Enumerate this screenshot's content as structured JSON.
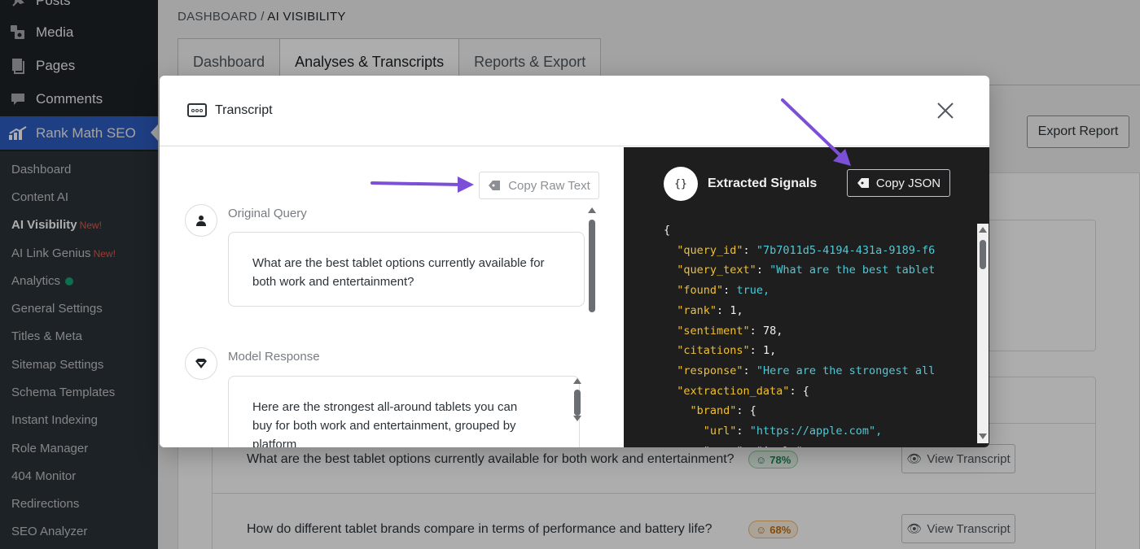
{
  "sidebar": {
    "top_items": [
      {
        "label": "Posts",
        "icon": "pin-icon"
      },
      {
        "label": "Media",
        "icon": "media-icon"
      },
      {
        "label": "Pages",
        "icon": "pages-icon"
      },
      {
        "label": "Comments",
        "icon": "comment-icon"
      },
      {
        "label": "Rank Math SEO",
        "icon": "rank-math-icon"
      }
    ],
    "submenu": [
      {
        "label": "Dashboard"
      },
      {
        "label": "Content AI"
      },
      {
        "label": "AI Visibility",
        "badge": "New!"
      },
      {
        "label": "AI Link Genius",
        "badge": "New!"
      },
      {
        "label": "Analytics"
      },
      {
        "label": "General Settings"
      },
      {
        "label": "Titles & Meta"
      },
      {
        "label": "Sitemap Settings"
      },
      {
        "label": "Schema Templates"
      },
      {
        "label": "Instant Indexing"
      },
      {
        "label": "Role Manager"
      },
      {
        "label": "404 Monitor"
      },
      {
        "label": "Redirections"
      },
      {
        "label": "SEO Analyzer"
      }
    ]
  },
  "breadcrumb": {
    "root": "DASHBOARD",
    "sep": "/",
    "current": "AI VISIBILITY"
  },
  "tabs": [
    {
      "label": "Dashboard"
    },
    {
      "label": "Analyses & Transcripts"
    },
    {
      "label": "Reports & Export"
    }
  ],
  "export_button": "Export Report",
  "rows": [
    {
      "query": "What are the best tablet options currently available for both work and entertainment?",
      "score": "78%",
      "action": "View Transcript"
    },
    {
      "query": "How do different tablet brands compare in terms of performance and battery life?",
      "score": "68%",
      "action": "View Transcript"
    }
  ],
  "modal": {
    "title": "Transcript",
    "copy_raw_label": "Copy Raw Text",
    "original_query_label": "Original Query",
    "original_query_text": "What are the best tablet options currently available for both work and entertainment?",
    "model_response_label": "Model Response",
    "model_response_text": "Here are the strongest all-around tablets you can buy for both work and entertainment, grouped by platform",
    "extracted_title": "Extracted Signals",
    "copy_json_label": "Copy JSON",
    "json_lines": [
      {
        "indent": 0,
        "key": "",
        "val": "{",
        "vtype": "p"
      },
      {
        "indent": 1,
        "key": "\"query_id\"",
        "val": "\"7b7011d5-4194-431a-9189-f6",
        "vtype": "s"
      },
      {
        "indent": 1,
        "key": "\"query_text\"",
        "val": "\"What are the best tablet",
        "vtype": "s"
      },
      {
        "indent": 1,
        "key": "\"found\"",
        "val": "true,",
        "vtype": "b"
      },
      {
        "indent": 1,
        "key": "\"rank\"",
        "val": "1,",
        "vtype": "v"
      },
      {
        "indent": 1,
        "key": "\"sentiment\"",
        "val": "78,",
        "vtype": "v"
      },
      {
        "indent": 1,
        "key": "\"citations\"",
        "val": "1,",
        "vtype": "v"
      },
      {
        "indent": 1,
        "key": "\"response\"",
        "val": "\"Here are the strongest all",
        "vtype": "s"
      },
      {
        "indent": 1,
        "key": "\"extraction_data\"",
        "val": "{",
        "vtype": "v"
      },
      {
        "indent": 2,
        "key": "\"brand\"",
        "val": "{",
        "vtype": "v"
      },
      {
        "indent": 3,
        "key": "\"url\"",
        "val": "\"https://apple.com\",",
        "vtype": "s"
      },
      {
        "indent": 3,
        "key": "\"name\"",
        "val": "\"Apple\"",
        "vtype": "s"
      }
    ]
  },
  "colors": {
    "sidebar_bg": "#1d2327",
    "active_menu": "#2f5ec4",
    "annotation_arrow": "#7b4fd6",
    "json_key": "#f0c030",
    "json_string": "#4ec9d6"
  }
}
